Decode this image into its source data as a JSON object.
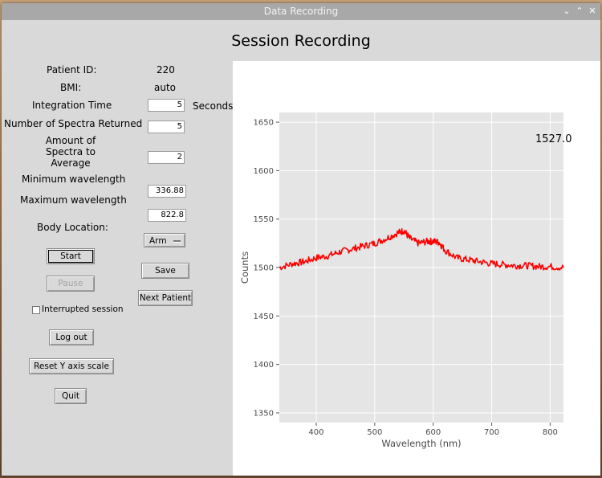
{
  "window": {
    "title": "Data Recording"
  },
  "heading": "Session Recording",
  "form": {
    "patient_id_label": "Patient ID:",
    "patient_id_value": "220",
    "bmi_label": "BMI:",
    "bmi_value": "auto",
    "integration_label": "Integration Time",
    "integration_value": "5",
    "integration_unit": "Seconds",
    "spectra_returned_label": "Number of Spectra Returned",
    "spectra_returned_value": "5",
    "avg_label_line1": "Amount of",
    "avg_label_line2": "Spectra to",
    "avg_label_line3": "Average",
    "avg_value": "2",
    "min_wl_label": "Minimum wavelength",
    "min_wl_value": "336.88",
    "max_wl_label": "Maximum wavelength",
    "max_wl_value": "822.8",
    "body_location_label": "Body Location:",
    "body_location_value": "Arm"
  },
  "buttons": {
    "start": "Start",
    "pause": "Pause",
    "save": "Save",
    "next_patient": "Next Patient",
    "interrupted": "Interrupted session",
    "logout": "Log out",
    "reset_y": "Reset Y axis scale",
    "quit": "Quit"
  },
  "chart_data": {
    "type": "line",
    "xlabel": "Wavelength (nm)",
    "ylabel": "Counts",
    "xlim": [
      336.88,
      822.8
    ],
    "ylim": [
      1340,
      1660
    ],
    "xticks": [
      400,
      500,
      600,
      700,
      800
    ],
    "yticks": [
      1350,
      1400,
      1450,
      1500,
      1550,
      1600,
      1650
    ],
    "grid": true,
    "annotation": "1527.0",
    "series": [
      {
        "color": "#ff0000",
        "x": [
          336.88,
          360,
          380,
          400,
          420,
          440,
          460,
          480,
          500,
          520,
          540,
          550,
          560,
          575,
          590,
          600,
          610,
          620,
          640,
          660,
          680,
          700,
          720,
          740,
          760,
          780,
          800,
          822.8
        ],
        "y": [
          1500,
          1504,
          1506,
          1510,
          1512,
          1516,
          1519,
          1522,
          1525,
          1530,
          1536,
          1538,
          1530,
          1525,
          1527,
          1527,
          1526,
          1518,
          1510,
          1508,
          1506,
          1504,
          1503,
          1502,
          1502,
          1501,
          1501,
          1500
        ]
      }
    ]
  }
}
